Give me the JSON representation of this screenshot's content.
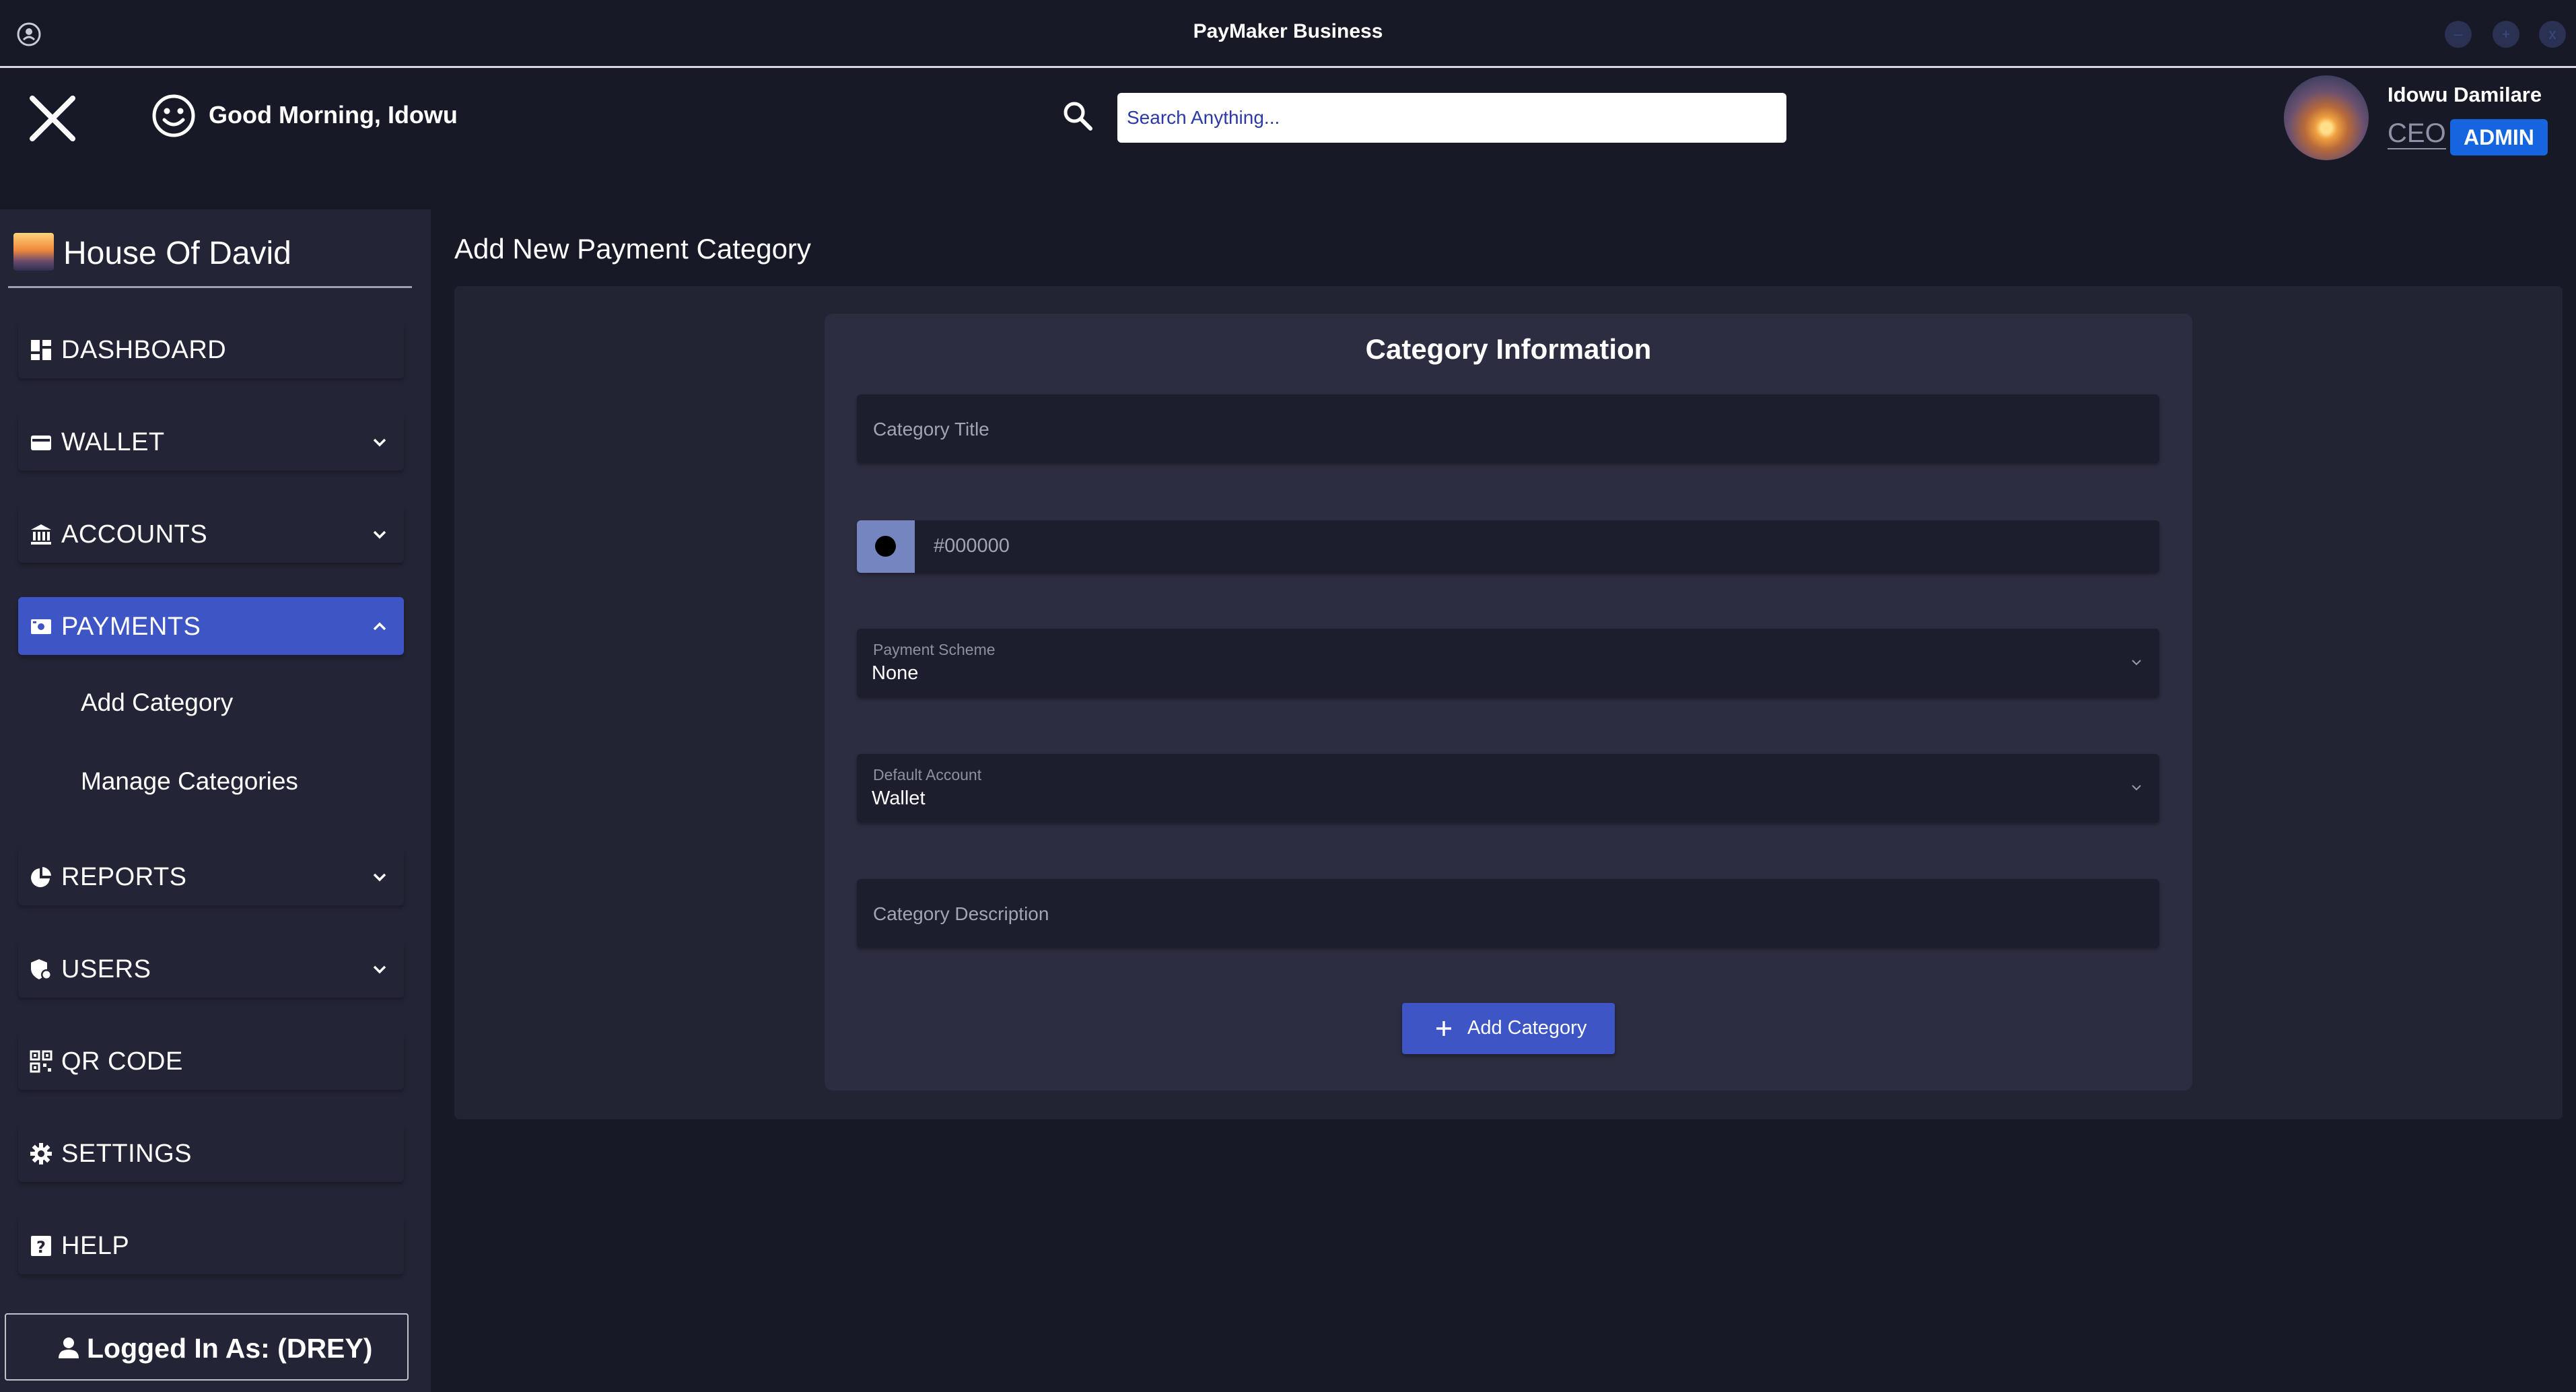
{
  "window": {
    "title": "PayMaker Business",
    "controls": [
      "–",
      "+",
      "x"
    ]
  },
  "header": {
    "greeting": "Good Morning, Idowu",
    "search_placeholder": "Search Anything...",
    "user": {
      "name": "Idowu Damilare",
      "role": "CEO",
      "badge": "ADMIN"
    }
  },
  "sidebar": {
    "org_name": "House Of David",
    "items": [
      {
        "label": "DASHBOARD",
        "icon": "dashboard-icon"
      },
      {
        "label": "WALLET",
        "icon": "wallet-icon"
      },
      {
        "label": "ACCOUNTS",
        "icon": "bank-icon"
      },
      {
        "label": "PAYMENTS",
        "icon": "payments-icon"
      },
      {
        "label": "REPORTS",
        "icon": "pie-chart-icon"
      },
      {
        "label": "USERS",
        "icon": "users-icon"
      },
      {
        "label": "QR CODE",
        "icon": "qr-code-icon"
      },
      {
        "label": "SETTINGS",
        "icon": "gear-icon"
      },
      {
        "label": "HELP",
        "icon": "help-icon"
      }
    ],
    "payments_sub": [
      "Add Category",
      "Manage Categories"
    ],
    "logged_in": "Logged In As: (DREY)"
  },
  "main": {
    "page_title": "Add New Payment Category",
    "card_title": "Category Information",
    "category_title_placeholder": "Category Title",
    "color_value": "#000000",
    "payment_scheme": {
      "label": "Payment Scheme",
      "value": "None"
    },
    "default_account": {
      "label": "Default Account",
      "value": "Wallet"
    },
    "description_placeholder": "Category Description",
    "submit_label": "Add Category"
  },
  "colors": {
    "background": "#181927",
    "sidebar": "#232435",
    "accent": "#3d55c5",
    "admin_badge": "#1565e0"
  }
}
